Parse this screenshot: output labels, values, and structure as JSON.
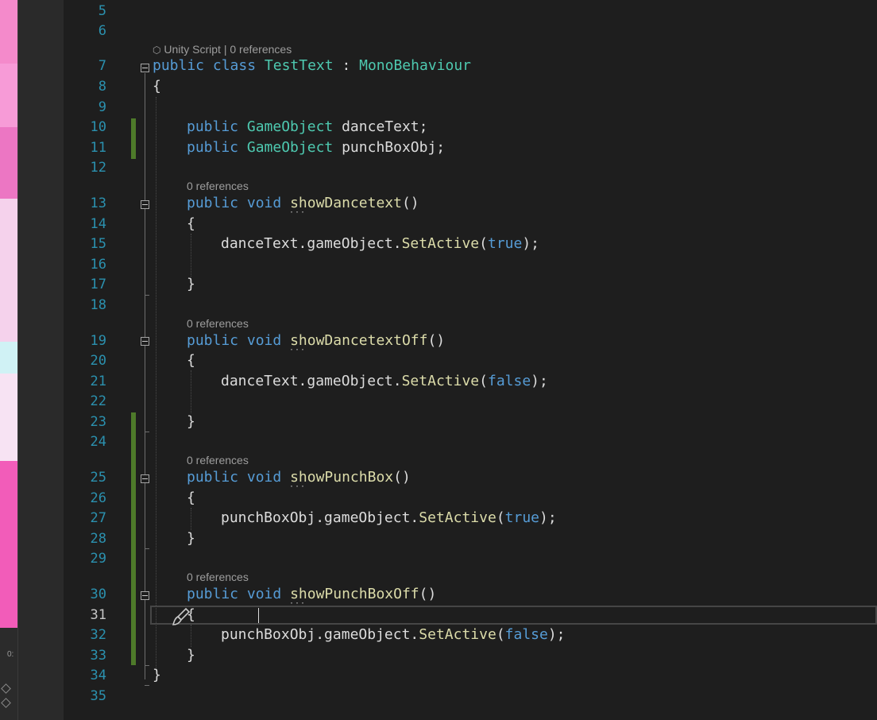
{
  "line_numbers": [
    "5",
    "6",
    "7",
    "8",
    "9",
    "10",
    "11",
    "12",
    "13",
    "14",
    "15",
    "16",
    "17",
    "18",
    "19",
    "20",
    "21",
    "22",
    "23",
    "24",
    "25",
    "26",
    "27",
    "28",
    "29",
    "30",
    "31",
    "32",
    "33",
    "34",
    "35"
  ],
  "codelens": {
    "unity_script": "Unity Script",
    "separator": "|",
    "zero_refs": "0 references"
  },
  "code": {
    "class_decl": {
      "kw1": "public",
      "kw2": "class",
      "name": "TestText",
      "colon": " : ",
      "base": "MonoBehaviour"
    },
    "open_brace": "{",
    "close_brace": "}",
    "field1": {
      "kw": "public",
      "type": "GameObject",
      "name": "danceText;"
    },
    "field2": {
      "kw": "public",
      "type": "GameObject",
      "name": "punchBoxObj;"
    },
    "methods": [
      {
        "name": "showDancetext",
        "parens": "()",
        "target": "danceText",
        "member": ".gameObject.",
        "call": "SetActive",
        "arg": "true"
      },
      {
        "name": "showDancetextOff",
        "parens": "()",
        "target": "danceText",
        "member": ".gameObject.",
        "call": "SetActive",
        "arg": "false"
      },
      {
        "name": "showPunchBox",
        "parens": "()",
        "target": "punchBoxObj",
        "member": ".gameObject.",
        "call": "SetActive",
        "arg": "true"
      },
      {
        "name": "showPunchBoxOff",
        "parens": "()",
        "target": "punchBoxObj",
        "member": ".gameObject.",
        "call": "SetActive",
        "arg": "false"
      }
    ],
    "kw_public": "public",
    "kw_void": "void",
    "open_paren": "(",
    "close_paren_semi": ");"
  },
  "left_panel": {
    "timeline_label": "0:"
  },
  "colors": {
    "background": "#1e1e1e",
    "line_number": "#2b91af",
    "keyword": "#569cd6",
    "type": "#4ec9b0",
    "method": "#dcdcaa",
    "change_bar": "#4e7a2a"
  },
  "icons": {
    "brush": "paintbrush-icon",
    "fold": "collapse-icon",
    "unity": "unity-cube-icon"
  }
}
